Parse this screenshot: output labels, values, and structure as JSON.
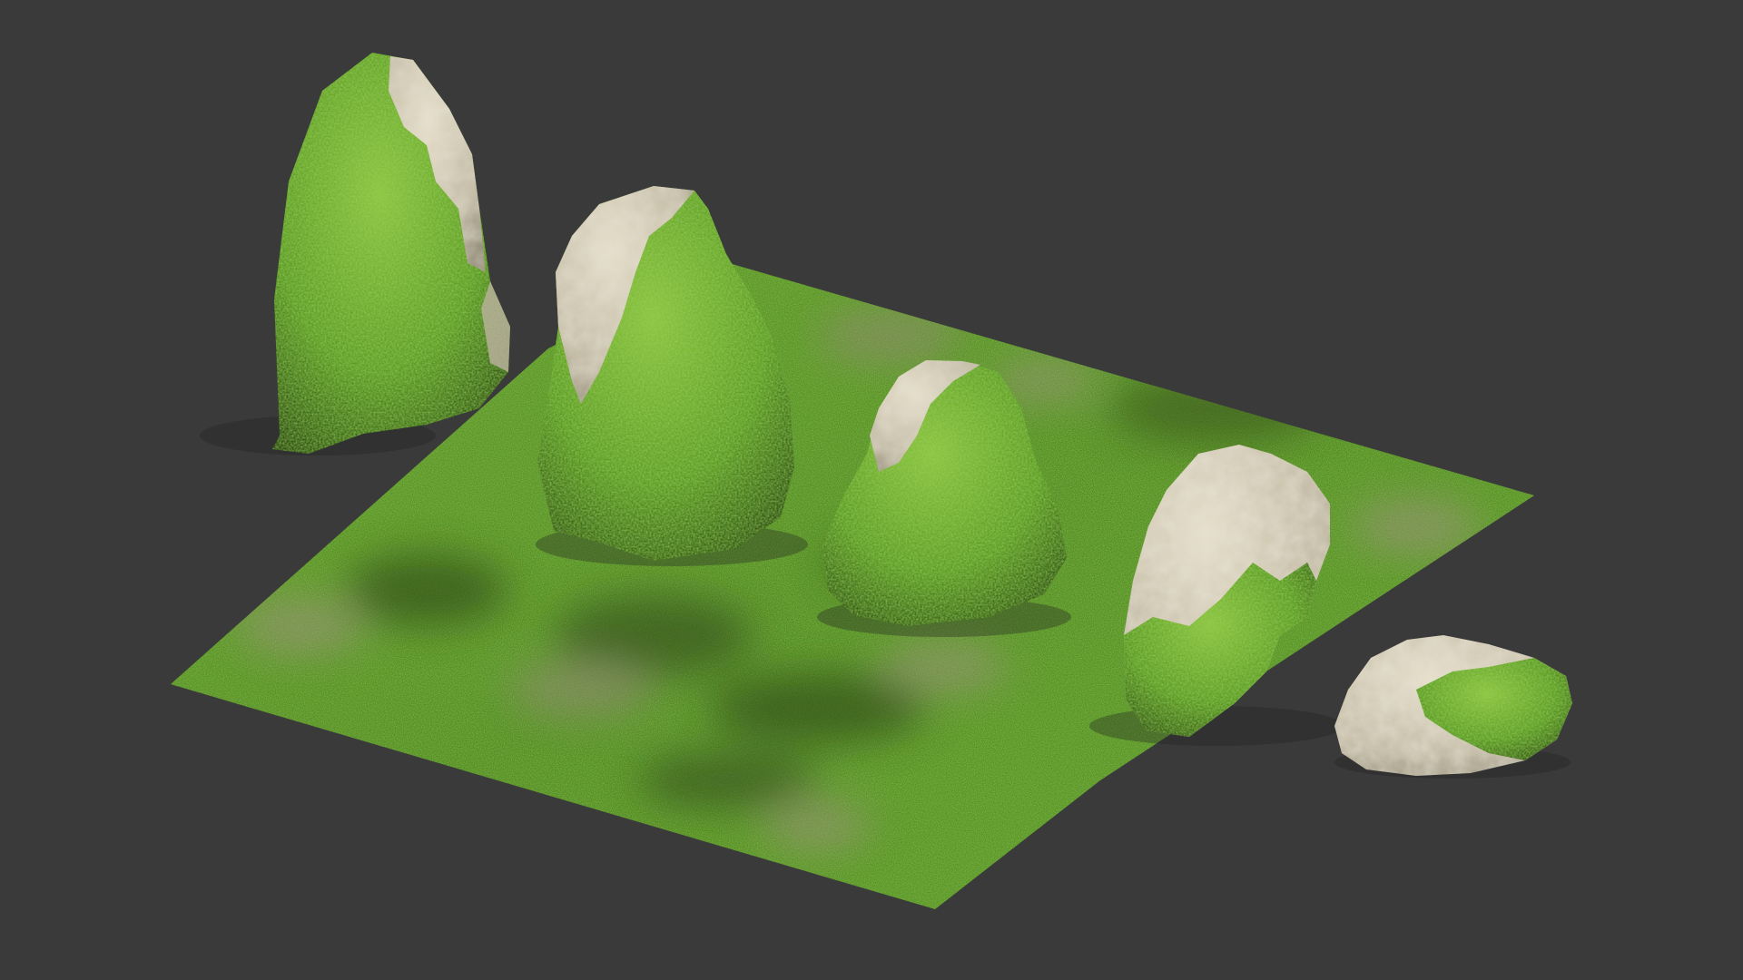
{
  "scene": {
    "background": "#3a3a3a",
    "assets": [
      {
        "kind": "ground-tile",
        "material": "moss-grass",
        "colors": {
          "base": "#4f8a1e",
          "light": "#76b82f",
          "dark": "#2f4f14",
          "bare": "#8c8a6a"
        }
      },
      {
        "kind": "standing-stone",
        "variant": "tall",
        "moss_coverage": 0.75
      },
      {
        "kind": "standing-stone",
        "variant": "medium",
        "moss_coverage": 0.65
      },
      {
        "kind": "boulder",
        "variant": "rounded",
        "moss_coverage": 0.7
      },
      {
        "kind": "boulder",
        "variant": "angular",
        "moss_coverage": 0.35
      },
      {
        "kind": "rock",
        "variant": "flat",
        "moss_coverage": 0.3
      }
    ],
    "colors": {
      "moss": "#5a9a22",
      "moss_light": "#86c238",
      "moss_dark": "#2c4a10",
      "stone": "#c9c2ad",
      "stone_shadow": "#8e8874"
    }
  }
}
